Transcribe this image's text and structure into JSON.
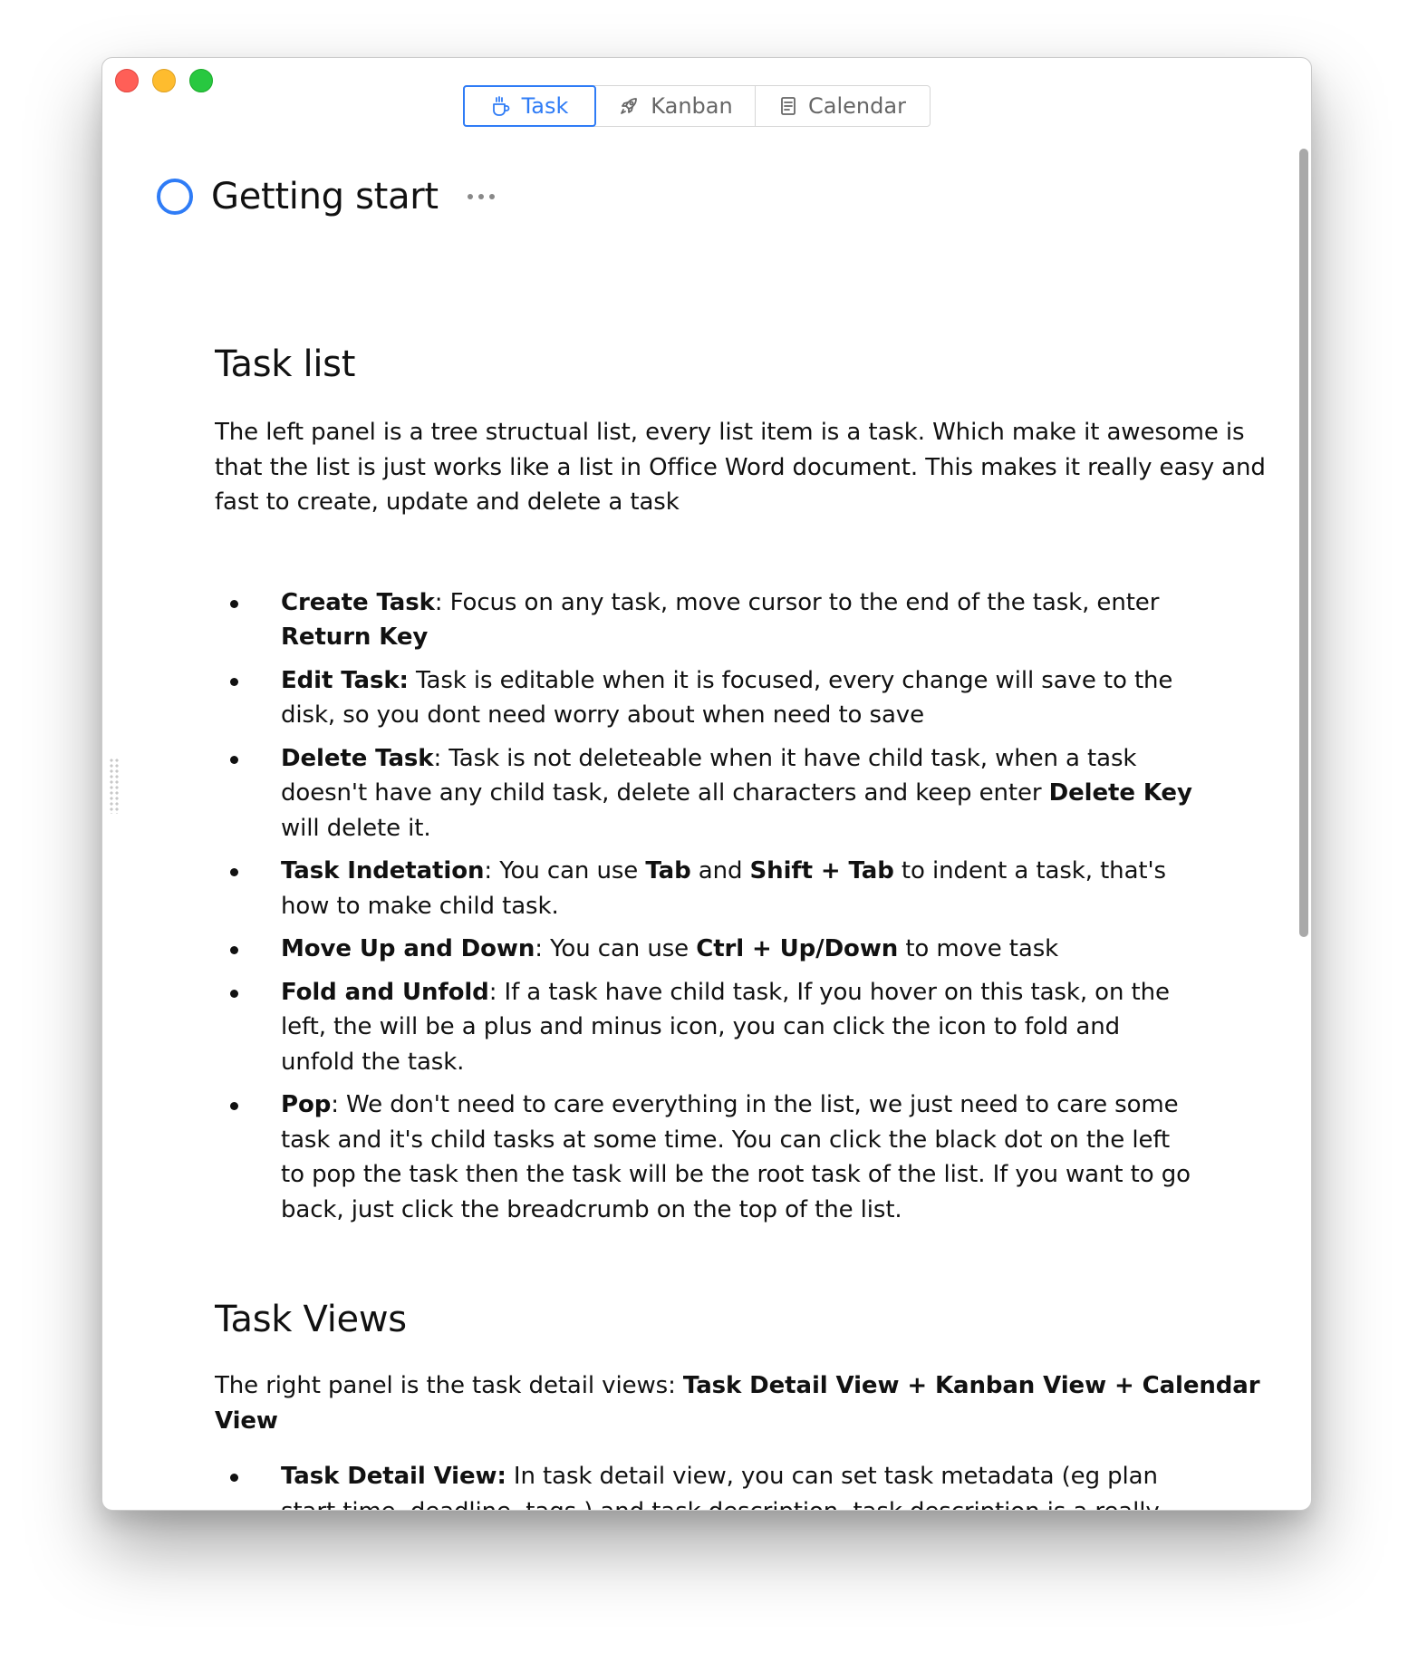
{
  "tabs": [
    {
      "label": "Task",
      "icon": "cup-icon",
      "active": true
    },
    {
      "label": "Kanban",
      "icon": "rocket-icon",
      "active": false
    },
    {
      "label": "Calendar",
      "icon": "calendar-icon",
      "active": false
    }
  ],
  "colors": {
    "accent": "#2f7cf6",
    "text": "#111111",
    "muted": "#666666"
  },
  "page": {
    "title": "Getting start",
    "status_icon": "circle-outline-icon",
    "more_icon": "more-horizontal-icon"
  },
  "sections": {
    "task_list": {
      "title": "Task list",
      "intro": "The left panel is a tree structual list, every list item is a task. Which make it awesome is that the list is just works like a list in Office Word document. This makes it really easy and fast to create, update and delete a task",
      "items": [
        {
          "runs": [
            {
              "text": "Create Task",
              "bold": true
            },
            {
              "text": ":  Focus on any task, move cursor to the end of the task, enter "
            },
            {
              "text": "Return Key",
              "bold": true
            }
          ]
        },
        {
          "runs": [
            {
              "text": "Edit Task:",
              "bold": true
            },
            {
              "text": " Task is editable when it is focused, every change will save to the disk, so you dont need worry about when need to save"
            }
          ]
        },
        {
          "runs": [
            {
              "text": "Delete Task",
              "bold": true
            },
            {
              "text": ": Task is not deleteable when it have child task, when a task doesn't have any child task, delete all characters and keep enter "
            },
            {
              "text": "Delete Key",
              "bold": true
            },
            {
              "text": " will delete it."
            }
          ]
        },
        {
          "runs": [
            {
              "text": "Task Indetation",
              "bold": true
            },
            {
              "text": ": You can use "
            },
            {
              "text": "Tab",
              "bold": true
            },
            {
              "text": " and "
            },
            {
              "text": "Shift + Tab",
              "bold": true
            },
            {
              "text": " to indent a task, that's how to make child task."
            }
          ]
        },
        {
          "runs": [
            {
              "text": "Move Up and Down",
              "bold": true
            },
            {
              "text": ": You can use "
            },
            {
              "text": "Ctrl + Up/Down",
              "bold": true
            },
            {
              "text": " to move task"
            }
          ]
        },
        {
          "runs": [
            {
              "text": "Fold and Unfold",
              "bold": true
            },
            {
              "text": ": If a task have child task, If you hover on this task, on the left, the will be a plus and minus icon, you can click the icon to fold and unfold the task."
            }
          ]
        },
        {
          "runs": [
            {
              "text": "Pop",
              "bold": true
            },
            {
              "text": ": We don't need to care everything in the list, we just need to care some task and it's child tasks at some time. You can click the black dot on the left to pop the task then the task will be the root task of the list. If you want to go back, just click the breadcrumb on the top of the list."
            }
          ]
        }
      ]
    },
    "task_views": {
      "title": "Task Views",
      "intro_runs": [
        {
          "text": "The right panel is the task detail views: "
        },
        {
          "text": "Task Detail View + Kanban View + Calendar View",
          "bold": true
        }
      ],
      "items": [
        {
          "runs": [
            {
              "text": "Task Detail View:",
              "bold": true
            },
            {
              "text": " In task detail view, you can set task metadata (eg plan start time, deadline, tags ) and task description, task description is a really powerful"
            }
          ]
        }
      ]
    }
  }
}
